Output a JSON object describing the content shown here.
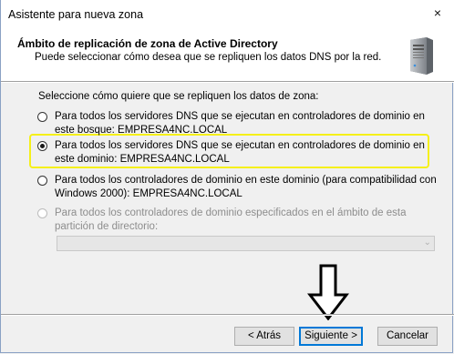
{
  "window": {
    "title": "Asistente para nueva zona",
    "close_glyph": "×"
  },
  "header": {
    "title": "Ámbito de replicación de zona de Active Directory",
    "subtitle": "Puede seleccionar cómo desea que se repliquen los datos DNS por la red.",
    "icon": "server-icon"
  },
  "body": {
    "prompt": "Seleccione cómo quiere que se repliquen los datos de zona:",
    "options": [
      {
        "label": "Para todos los servidores DNS que se ejecutan en controladores de dominio en este bosque: EMPRESA4NC.LOCAL",
        "checked": false,
        "disabled": false
      },
      {
        "label": "Para todos los servidores DNS que se ejecutan en controladores de dominio en este dominio: EMPRESA4NC.LOCAL",
        "checked": true,
        "disabled": false
      },
      {
        "label": "Para todos los controladores de dominio en este dominio (para compatibilidad con Windows 2000): EMPRESA4NC.LOCAL",
        "checked": false,
        "disabled": false
      },
      {
        "label": "Para todos los controladores de dominio especificados en el ámbito de esta partición de directorio:",
        "checked": false,
        "disabled": true
      }
    ],
    "partition_select": {
      "value": "",
      "disabled": true
    },
    "highlight_color": "#f5f018"
  },
  "buttons": {
    "back": "< Atrás",
    "next": "Siguiente >",
    "cancel": "Cancelar"
  }
}
